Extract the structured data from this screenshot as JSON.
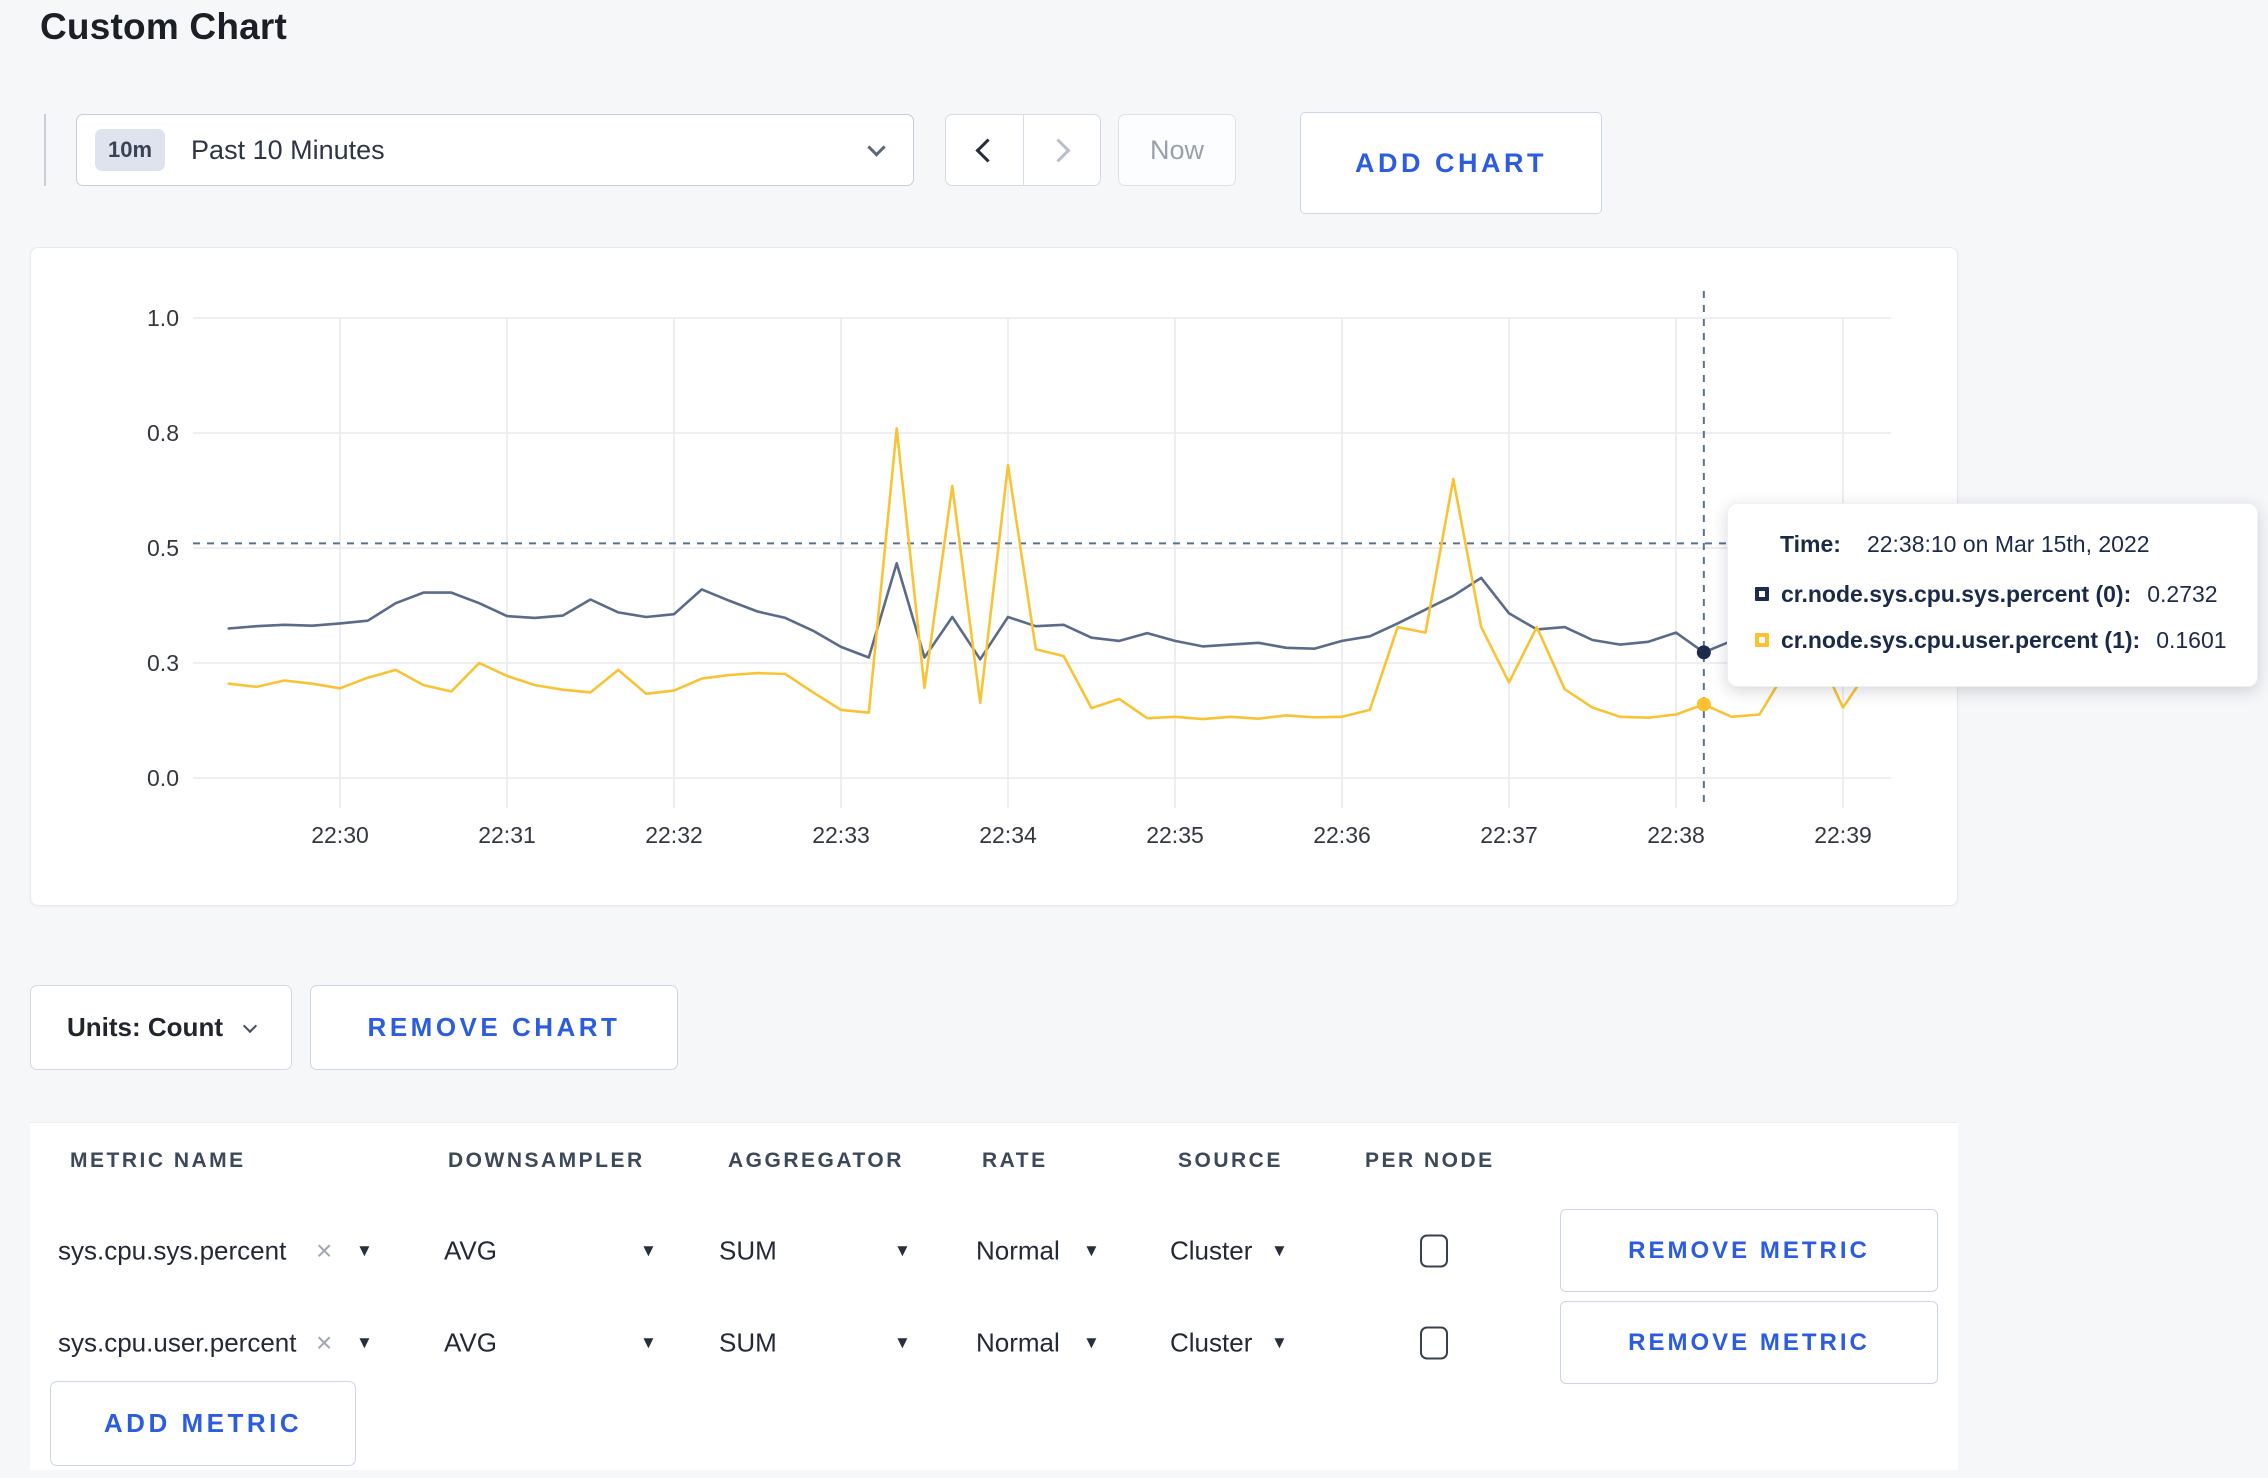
{
  "page": {
    "title": "Custom Chart"
  },
  "colors": {
    "accent_blue": "#2c5ce0",
    "navy_series": "#5b6b89",
    "navy_swatch": "#1d2b4e",
    "yellow_series": "#f9c335",
    "yellow_swatch": "#fdc02f",
    "crosshair": "#5c718f",
    "grid": "#e8eaed"
  },
  "icons": {
    "caret_down_glyph": "▼",
    "close_glyph": "×"
  },
  "toolbar": {
    "time_badge": "10m",
    "time_label": "Past 10 Minutes",
    "now_label": "Now",
    "add_chart_label": "ADD CHART"
  },
  "chart_footer": {
    "units_label": "Units: Count",
    "remove_chart_label": "REMOVE CHART"
  },
  "tooltip": {
    "time_label": "Time:",
    "time_value": "22:38:10 on Mar 15th, 2022",
    "series": [
      {
        "name": "cr.node.sys.cpu.sys.percent (0):",
        "value": "0.2732",
        "swatch": "#1d2b4e"
      },
      {
        "name": "cr.node.sys.cpu.user.percent (1):",
        "value": "0.1601",
        "swatch": "#fdc02f"
      }
    ]
  },
  "metrics_table": {
    "headers": [
      "METRIC NAME",
      "DOWNSAMPLER",
      "AGGREGATOR",
      "RATE",
      "SOURCE",
      "PER NODE"
    ],
    "rows": [
      {
        "metric": "sys.cpu.sys.percent",
        "downsampler": "AVG",
        "aggregator": "SUM",
        "rate": "Normal",
        "source": "Cluster",
        "per_node_checked": false,
        "remove_label": "REMOVE METRIC"
      },
      {
        "metric": "sys.cpu.user.percent",
        "downsampler": "AVG",
        "aggregator": "SUM",
        "rate": "Normal",
        "source": "Cluster",
        "per_node_checked": false,
        "remove_label": "REMOVE METRIC"
      }
    ],
    "add_metric_label": "ADD METRIC"
  },
  "chart_data": {
    "type": "line",
    "title": "",
    "xlabel": "",
    "ylabel": "",
    "x_start_time": "22:29:20",
    "x_interval_seconds": 10,
    "xticks": [
      "22:30",
      "22:31",
      "22:32",
      "22:33",
      "22:34",
      "22:35",
      "22:36",
      "22:37",
      "22:38",
      "22:39"
    ],
    "yticks": [
      {
        "label": "0.0",
        "value": 0.0
      },
      {
        "label": "0.3",
        "value": 0.25
      },
      {
        "label": "0.5",
        "value": 0.5
      },
      {
        "label": "0.8",
        "value": 0.75
      },
      {
        "label": "1.0",
        "value": 1.0
      }
    ],
    "ylim": [
      0,
      1
    ],
    "grid": true,
    "legend_position": "tooltip",
    "series": [
      {
        "name": "cr.node.sys.cpu.sys.percent",
        "color": "#5b6b89",
        "values": [
          0.325,
          0.33,
          0.333,
          0.331,
          0.336,
          0.342,
          0.38,
          0.403,
          0.403,
          0.38,
          0.352,
          0.348,
          0.353,
          0.388,
          0.36,
          0.35,
          0.356,
          0.41,
          0.385,
          0.362,
          0.348,
          0.32,
          0.285,
          0.262,
          0.467,
          0.262,
          0.35,
          0.258,
          0.35,
          0.33,
          0.333,
          0.305,
          0.298,
          0.315,
          0.298,
          0.286,
          0.29,
          0.294,
          0.283,
          0.281,
          0.298,
          0.308,
          0.336,
          0.366,
          0.396,
          0.435,
          0.358,
          0.323,
          0.328,
          0.3,
          0.29,
          0.296,
          0.316,
          0.2732,
          0.298,
          0.294,
          0.298,
          0.308,
          0.31,
          0.328,
          0.29
        ]
      },
      {
        "name": "cr.node.sys.cpu.user.percent",
        "color": "#f9c335",
        "values": [
          0.205,
          0.198,
          0.212,
          0.205,
          0.195,
          0.218,
          0.235,
          0.202,
          0.188,
          0.25,
          0.222,
          0.202,
          0.192,
          0.186,
          0.235,
          0.183,
          0.19,
          0.216,
          0.224,
          0.228,
          0.226,
          0.186,
          0.148,
          0.142,
          0.76,
          0.196,
          0.635,
          0.163,
          0.68,
          0.28,
          0.265,
          0.152,
          0.172,
          0.13,
          0.133,
          0.128,
          0.133,
          0.129,
          0.136,
          0.132,
          0.133,
          0.148,
          0.328,
          0.316,
          0.65,
          0.328,
          0.208,
          0.328,
          0.193,
          0.153,
          0.133,
          0.131,
          0.138,
          0.1601,
          0.133,
          0.138,
          0.238,
          0.283,
          0.153,
          0.243,
          0.283
        ]
      }
    ],
    "crosshair": {
      "time": "22:38:10",
      "hline_value": 0.51,
      "point_values": [
        0.2732,
        0.1601
      ]
    }
  }
}
